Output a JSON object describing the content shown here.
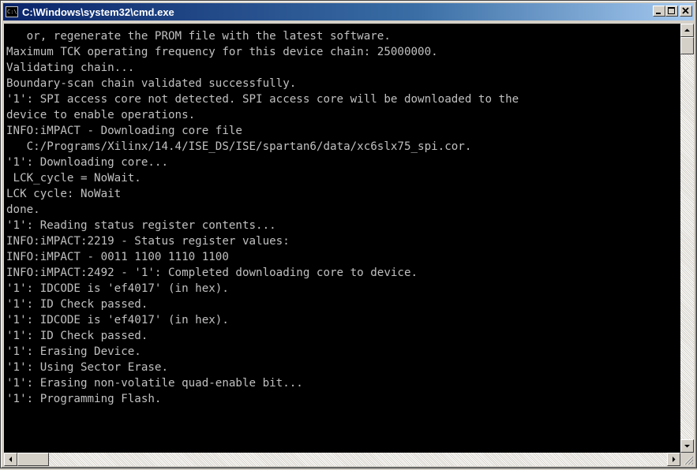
{
  "window": {
    "title": "C:\\Windows\\system32\\cmd.exe",
    "icon_text": "C:\\"
  },
  "console": {
    "lines": [
      "   or, regenerate the PROM file with the latest software.",
      "Maximum TCK operating frequency for this device chain: 25000000.",
      "Validating chain...",
      "Boundary-scan chain validated successfully.",
      "'1': SPI access core not detected. SPI access core will be downloaded to the",
      "device to enable operations.",
      "INFO:iMPACT - Downloading core file",
      "   C:/Programs/Xilinx/14.4/ISE_DS/ISE/spartan6/data/xc6slx75_spi.cor.",
      "'1': Downloading core...",
      " LCK_cycle = NoWait.",
      "LCK cycle: NoWait",
      "done.",
      "'1': Reading status register contents...",
      "INFO:iMPACT:2219 - Status register values:",
      "INFO:iMPACT - 0011 1100 1110 1100",
      "INFO:iMPACT:2492 - '1': Completed downloading core to device.",
      "'1': IDCODE is 'ef4017' (in hex).",
      "'1': ID Check passed.",
      "'1': IDCODE is 'ef4017' (in hex).",
      "'1': ID Check passed.",
      "'1': Erasing Device.",
      "'1': Using Sector Erase.",
      "'1': Erasing non-volatile quad-enable bit...",
      "'1': Programming Flash.",
      ""
    ]
  },
  "icons": {
    "minimize": "minimize-icon",
    "maximize": "maximize-icon",
    "close": "close-icon",
    "scroll_up": "arrow-up-icon",
    "scroll_down": "arrow-down-icon",
    "scroll_left": "arrow-left-icon",
    "scroll_right": "arrow-right-icon"
  }
}
